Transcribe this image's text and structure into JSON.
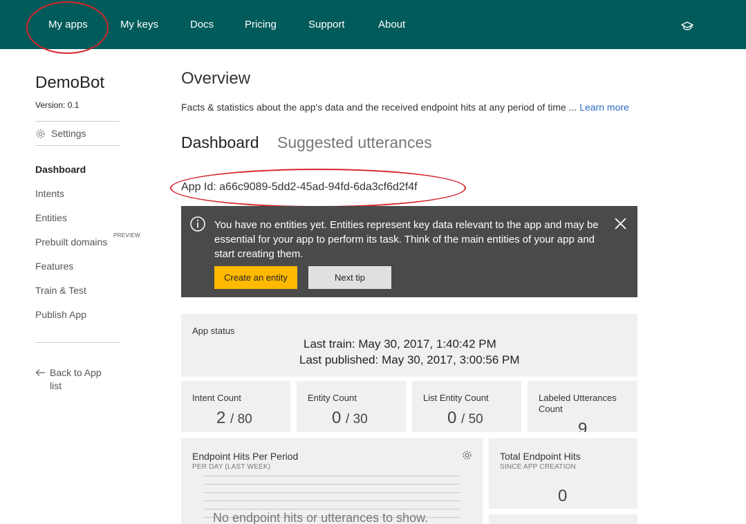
{
  "nav": {
    "items": [
      "My apps",
      "My keys",
      "Docs",
      "Pricing",
      "Support",
      "About"
    ],
    "account_icon": "graduation-cap-icon"
  },
  "sidebar": {
    "app_name": "DemoBot",
    "version_label": "Version:",
    "version_value": "0.1",
    "settings_label": "Settings",
    "items": [
      {
        "label": "Dashboard",
        "active": true
      },
      {
        "label": "Intents"
      },
      {
        "label": "Entities"
      },
      {
        "label": "Prebuilt domains",
        "badge": "PREVIEW"
      },
      {
        "label": "Features"
      },
      {
        "label": "Train & Test"
      },
      {
        "label": "Publish App"
      }
    ],
    "back_label": "Back to App list"
  },
  "main": {
    "title": "Overview",
    "description": "Facts & statistics about the app's data and the received endpoint hits at any period of time ...",
    "learn_more": "Learn more",
    "tabs": [
      "Dashboard",
      "Suggested utterances"
    ],
    "app_id": "App Id: a66c9089-5dd2-45ad-94fd-6da3cf6d2f4f"
  },
  "tip": {
    "text": "You have no entities yet. Entities represent key data relevant to the app and may be essential for your app to perform its task. Think of the main entities of your app and start creating them.",
    "primary_button": "Create an entity",
    "secondary_button": "Next tip"
  },
  "status": {
    "label": "App status",
    "last_train_label": "Last train:",
    "last_train_value": "May 30, 2017, 1:40:42 PM",
    "last_published_label": "Last published:",
    "last_published_value": "May 30, 2017, 3:00:56 PM"
  },
  "counts": [
    {
      "label": "Intent Count",
      "value": "2",
      "max": "80"
    },
    {
      "label": "Entity Count",
      "value": "0",
      "max": "30"
    },
    {
      "label": "List Entity Count",
      "value": "0",
      "max": "50"
    },
    {
      "label": "Labeled Utterances Count",
      "value": "9"
    }
  ],
  "endpoint": {
    "title": "Endpoint Hits Per Period",
    "subtitle": "PER DAY (LAST WEEK)",
    "empty_text": "No endpoint hits or utterances to show."
  },
  "total": {
    "title": "Total Endpoint Hits",
    "subtitle": "SINCE APP CREATION",
    "value": "0"
  },
  "colors": {
    "topbar": "#025b5b",
    "annotation": "#d6242a",
    "primary_button": "#ffb900",
    "tip_background": "#4a4a4a",
    "link": "#2a6bc8"
  }
}
